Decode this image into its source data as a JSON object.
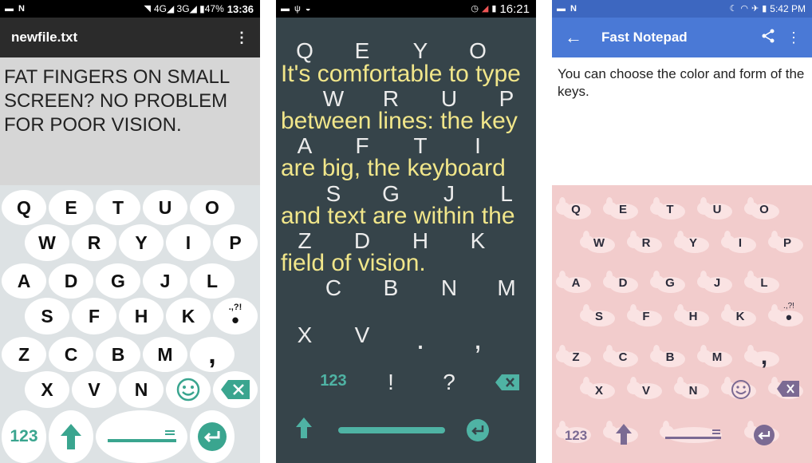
{
  "phone1": {
    "status": {
      "right_text": "4G◢ 3G◢ ▮47%",
      "time": "13:36"
    },
    "title": "newfile.txt",
    "text_lines": [
      "FAT FINGERS ON SMALL",
      "SCREEN? NO PROBLEM",
      "FOR POOR VISION."
    ],
    "keys": {
      "row1": [
        "Q",
        "E",
        "T",
        "U",
        "O"
      ],
      "row2": [
        "W",
        "R",
        "Y",
        "I",
        "P"
      ],
      "row3": [
        "A",
        "D",
        "G",
        "J",
        "L"
      ],
      "row4": [
        "S",
        "F",
        "H",
        "K"
      ],
      "row5": [
        "Z",
        "C",
        "B",
        "M"
      ],
      "row6": [
        "X",
        "V",
        "N"
      ],
      "punct_label": ".,?!",
      "dot": "•",
      "comma": ",",
      "num_label": "123",
      "accent": "#3aa58f"
    }
  },
  "phone2": {
    "status": {
      "time": "16:21"
    },
    "overlay_lines": [
      "It's comfortable to type",
      "between lines: the key",
      "are big, the keyboard",
      "and text are within the",
      "field of vision."
    ],
    "keys": {
      "row1": [
        "Q",
        "E",
        "Y",
        "O"
      ],
      "row2": [
        "W",
        "R",
        "U",
        "P"
      ],
      "row3": [
        "A",
        "F",
        "T",
        "I"
      ],
      "row4": [
        "S",
        "G",
        "J",
        "L"
      ],
      "row5": [
        "Z",
        "D",
        "H",
        "K"
      ],
      "row6": [
        "C",
        "B",
        "N",
        "M"
      ],
      "row7": [
        "X",
        "V",
        ".",
        ","
      ],
      "num_label": "123",
      "excl": "!",
      "question": "?",
      "accent": "#4fb3a4",
      "text_color": "#f1e68a"
    }
  },
  "phone3": {
    "status": {
      "time": "5:42 PM"
    },
    "title": "Fast Notepad",
    "text": "You can choose the color and form of the keys.",
    "keys": {
      "row1": [
        "Q",
        "E",
        "T",
        "U",
        "O"
      ],
      "row2": [
        "W",
        "R",
        "Y",
        "I",
        "P"
      ],
      "row3": [
        "A",
        "D",
        "G",
        "J",
        "L"
      ],
      "row4": [
        "S",
        "F",
        "H",
        "K"
      ],
      "row5": [
        "Z",
        "C",
        "B",
        "M"
      ],
      "row6": [
        "X",
        "V",
        "N"
      ],
      "punct_label": ".,?!",
      "dot": "•",
      "comma": ",",
      "num_label": "123",
      "accent": "#7b6a93"
    }
  }
}
